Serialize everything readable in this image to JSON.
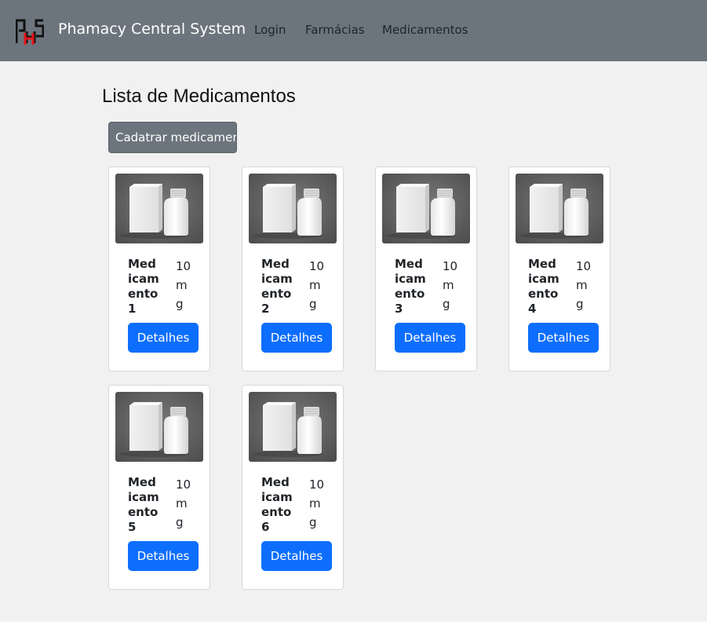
{
  "navbar": {
    "brand": "Phamacy Central System",
    "links": [
      {
        "label": "Login"
      },
      {
        "label": "Farmácias"
      },
      {
        "label": "Medicamentos"
      }
    ],
    "logo_colors": {
      "primary": "#111111",
      "accent": "#e3151a"
    }
  },
  "colors": {
    "navbar_bg": "#6c757d",
    "page_bg": "#f1f1f1",
    "primary_button": "#0d6efd",
    "secondary_button": "#6c757d"
  },
  "main": {
    "title": "Lista de Medicamentos",
    "add_button_label": "Cadatrar medicamento",
    "cards": [
      {
        "name": "Medicamento 1",
        "dose": "10mg",
        "button": "Detalhes",
        "image": "medicine-box-bottle-image"
      },
      {
        "name": "Medicamento 2",
        "dose": "10mg",
        "button": "Detalhes",
        "image": "medicine-box-bottle-image"
      },
      {
        "name": "Medicamento 3",
        "dose": "10mg",
        "button": "Detalhes",
        "image": "medicine-box-bottle-image"
      },
      {
        "name": "Medicamento 4",
        "dose": "10mg",
        "button": "Detalhes",
        "image": "medicine-box-bottle-image"
      },
      {
        "name": "Medicamento 5",
        "dose": "10mg",
        "button": "Detalhes",
        "image": "medicine-box-bottle-image"
      },
      {
        "name": "Medicamento 6",
        "dose": "10mg",
        "button": "Detalhes",
        "image": "medicine-box-bottle-image"
      }
    ]
  }
}
